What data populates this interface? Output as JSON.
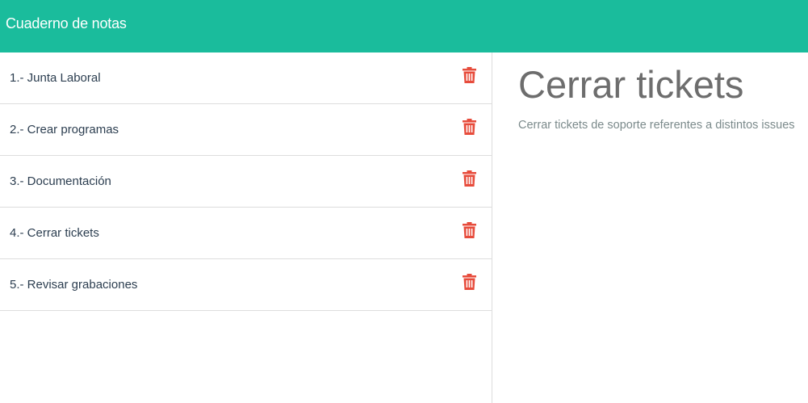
{
  "navbar": {
    "brand": "Cuaderno de notas"
  },
  "notes": [
    {
      "label": "1.- Junta Laboral",
      "delete_icon": "trash-icon"
    },
    {
      "label": "2.- Crear programas",
      "delete_icon": "trash-icon"
    },
    {
      "label": "3.- Documentación",
      "delete_icon": "trash-icon"
    },
    {
      "label": "4.- Cerrar tickets",
      "delete_icon": "trash-icon"
    },
    {
      "label": "5.- Revisar grabaciones",
      "delete_icon": "trash-icon"
    }
  ],
  "detail": {
    "title": "Cerrar tickets",
    "body": "Cerrar tickets de soporte referentes a distintos issues"
  },
  "colors": {
    "navbar": "#1abc9c",
    "trash": "#e74c3c",
    "divider": "#dddddd"
  }
}
